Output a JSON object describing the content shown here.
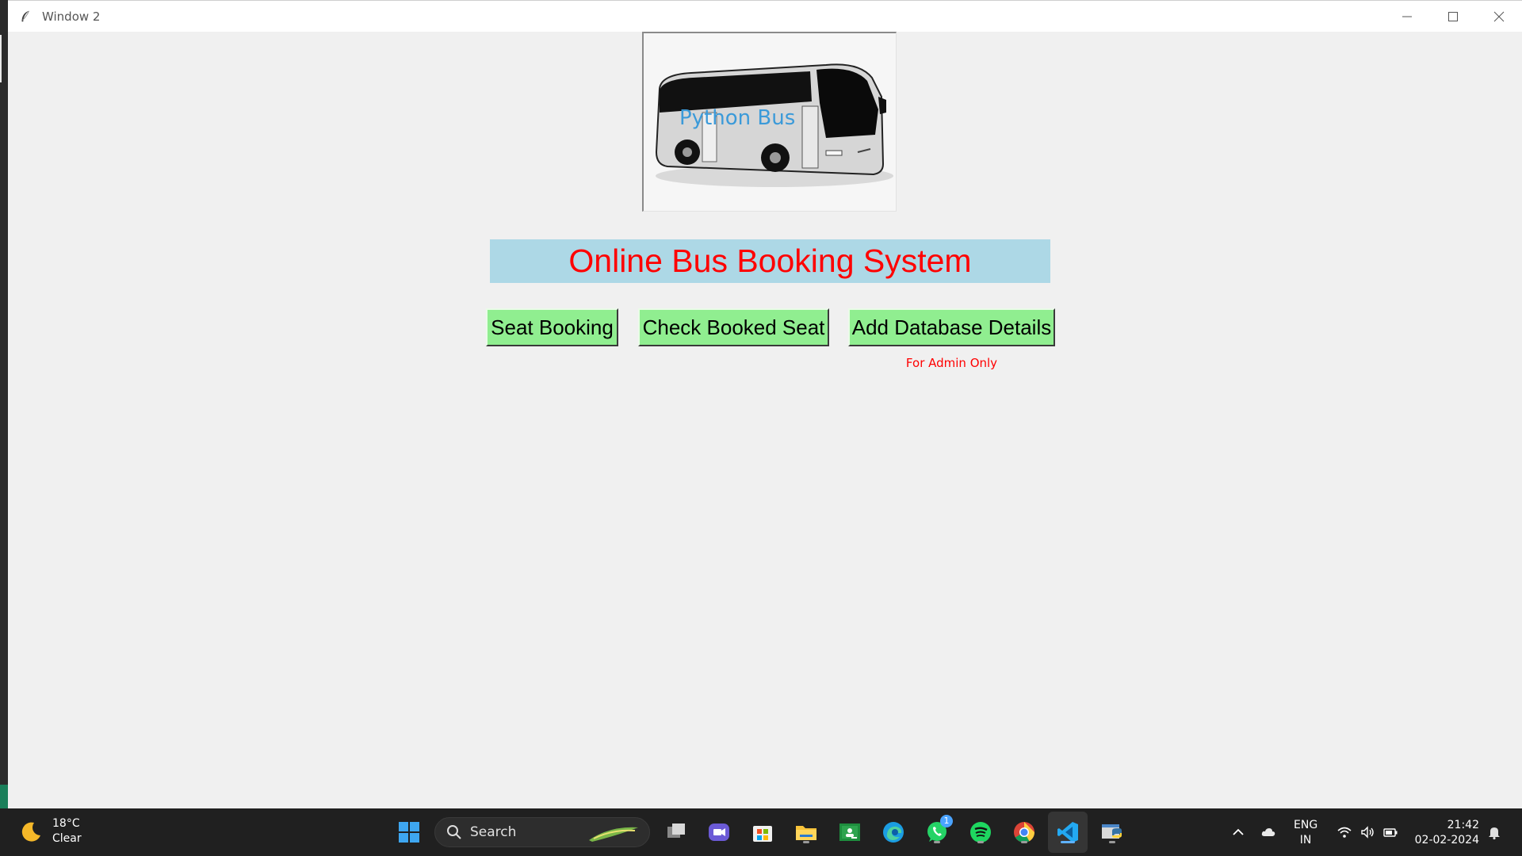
{
  "window": {
    "title": "Window 2",
    "controls": {
      "minimize": "minimize-icon",
      "maximize": "maximize-icon",
      "close": "close-icon"
    }
  },
  "logo": {
    "text": "Python Bus"
  },
  "app": {
    "heading": "Online Bus Booking System",
    "buttons": {
      "seat_booking": "Seat Booking",
      "check_booked": "Check Booked Seat",
      "add_database": "Add Database Details"
    },
    "admin_note": "For Admin Only"
  },
  "colors": {
    "heading_bg": "#add8e6",
    "heading_text": "#ff0000",
    "button_bg": "#90ee90",
    "note_text": "#ff0000"
  },
  "taskbar": {
    "weather": {
      "temp": "18°C",
      "condition": "Clear"
    },
    "search_placeholder": "Search",
    "whatsapp_badge": "1",
    "language": {
      "line1": "ENG",
      "line2": "IN"
    },
    "clock": {
      "time": "21:42",
      "date": "02-02-2024"
    }
  }
}
